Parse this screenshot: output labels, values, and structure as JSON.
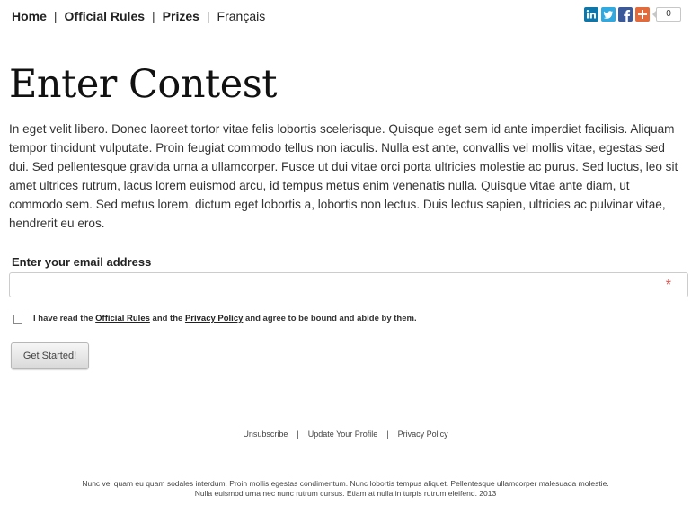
{
  "nav": {
    "home": "Home",
    "official_rules": "Official Rules",
    "prizes": "Prizes",
    "language": "Français",
    "separator": "|"
  },
  "social": {
    "icons": [
      "linkedin-icon",
      "twitter-icon",
      "facebook-icon",
      "google-plus-icon"
    ],
    "share_count": "0",
    "colors": {
      "linkedin": "#0e76a8",
      "twitter": "#2fa9e0",
      "facebook": "#3b5998",
      "google_plus": "#e36a3b"
    }
  },
  "main": {
    "title": "Enter Contest",
    "intro": "In eget velit libero. Donec laoreet tortor vitae felis lobortis scelerisque. Quisque eget sem id ante imperdiet facilisis. Aliquam tempor tincidunt vulputate. Proin feugiat commodo tellus non iaculis. Nulla est ante, convallis vel mollis vitae, egestas sed dui. Sed pellentesque gravida urna a ullamcorper. Fusce ut dui vitae orci porta ultricies molestie ac purus. Sed luctus, leo sit amet ultrices rutrum, lacus lorem euismod arcu, id tempus metus enim venenatis nulla. Quisque vitae ante diam, ut commodo sem. Sed metus lorem, dictum eget lobortis a, lobortis non lectus. Duis lectus sapien, ultricies ac pulvinar vitae, hendrerit eu eros."
  },
  "form": {
    "email_label": "Enter your email address",
    "email_value": "",
    "email_placeholder": "",
    "required_marker": "*",
    "agree_prefix": "I have read the ",
    "agree_rules_link": "Official Rules",
    "agree_middle": " and the ",
    "agree_privacy_link": "Privacy Policy",
    "agree_suffix": " and agree to be bound and abide by them.",
    "submit_label": "Get Started!"
  },
  "footer": {
    "links": [
      "Unsubscribe",
      "Update Your Profile",
      "Privacy Policy"
    ],
    "separator": "|",
    "text_line1": "Nunc vel quam eu quam sodales interdum. Proin mollis egestas condimentum. Nunc lobortis tempus aliquet. Pellentesque ullamcorper malesuada molestie.",
    "text_line2": "Nulla euismod urna nec nunc rutrum cursus. Etiam at nulla in turpis rutrum eleifend. 2013"
  }
}
